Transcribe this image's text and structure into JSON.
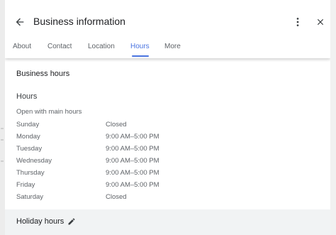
{
  "header": {
    "title": "Business information",
    "back_icon": "arrow-left-icon",
    "more_icon": "more-vert-icon",
    "close_icon": "close-icon"
  },
  "tabs": [
    {
      "label": "About",
      "active": false
    },
    {
      "label": "Contact",
      "active": false
    },
    {
      "label": "Location",
      "active": false
    },
    {
      "label": "Hours",
      "active": true
    },
    {
      "label": "More",
      "active": false
    }
  ],
  "business_hours": {
    "section_title": "Business hours",
    "subtitle": "Hours",
    "note": "Open with main hours",
    "days": [
      {
        "day": "Sunday",
        "hours": "Closed"
      },
      {
        "day": "Monday",
        "hours": "9:00 AM–5:00 PM"
      },
      {
        "day": "Tuesday",
        "hours": "9:00 AM–5:00 PM"
      },
      {
        "day": "Wednesday",
        "hours": "9:00 AM–5:00 PM"
      },
      {
        "day": "Thursday",
        "hours": "9:00 AM–5:00 PM"
      },
      {
        "day": "Friday",
        "hours": "9:00 AM–5:00 PM"
      },
      {
        "day": "Saturday",
        "hours": "Closed"
      }
    ]
  },
  "holiday": {
    "label": "Holiday hours",
    "edit_icon": "pencil-icon"
  },
  "colors": {
    "accent": "#4a74e0",
    "text_primary": "#202124",
    "text_secondary": "#5f6368",
    "holiday_bg": "#f1f3f4"
  }
}
